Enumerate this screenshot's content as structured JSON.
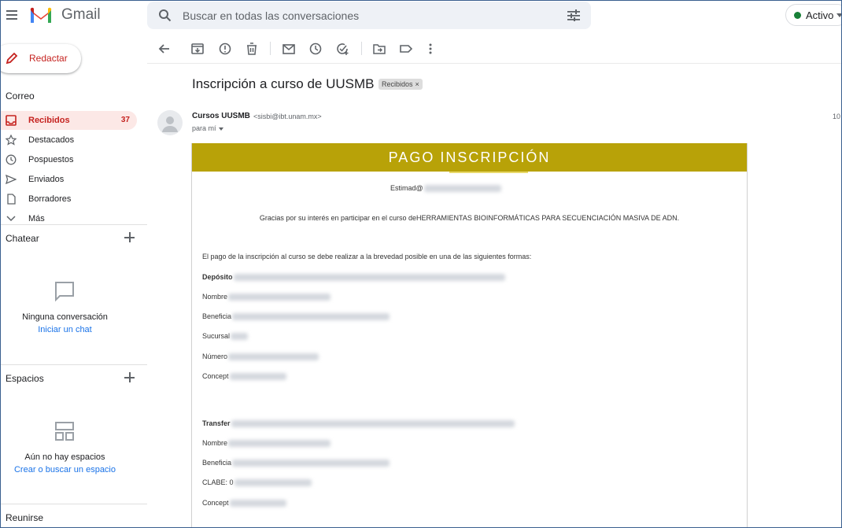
{
  "app": {
    "name": "Gmail"
  },
  "search": {
    "placeholder": "Buscar en todas las conversaciones"
  },
  "status": {
    "label": "Activo",
    "color": "#188038"
  },
  "sidebar": {
    "compose_label": "Redactar",
    "mail_section": "Correo",
    "items": [
      {
        "label": "Recibidos",
        "count": "37",
        "icon": "inbox-icon"
      },
      {
        "label": "Destacados",
        "icon": "star-icon"
      },
      {
        "label": "Pospuestos",
        "icon": "clock-icon"
      },
      {
        "label": "Enviados",
        "icon": "send-icon"
      },
      {
        "label": "Borradores",
        "icon": "draft-icon"
      },
      {
        "label": "Más",
        "icon": "chevron-down-icon"
      }
    ],
    "chat": {
      "title": "Chatear",
      "empty": "Ninguna conversación",
      "action": "Iniciar un chat"
    },
    "spaces": {
      "title": "Espacios",
      "empty": "Aún no hay espacios",
      "action": "Crear o buscar un espacio"
    },
    "meet": {
      "title": "Reunirse"
    }
  },
  "toolbar": {
    "icons": [
      "back-icon",
      "archive-icon",
      "report-spam-icon",
      "delete-icon",
      "mark-unread-icon",
      "snooze-icon",
      "add-task-icon",
      "move-to-icon",
      "label-icon",
      "more-icon"
    ]
  },
  "message": {
    "subject": "Inscripción a curso de UUSMB",
    "label_chip": "Recibidos",
    "sender_name": "Cursos UUSMB",
    "sender_email": "<sisbi@ibt.unam.mx>",
    "to": "para mí",
    "time": "10"
  },
  "email": {
    "banner": "PAGO INSCRIPCIÓN",
    "banner_color": "#b8a208",
    "greeting": "Estimad@",
    "intro": "Gracias por su interés en participar en el curso deHERRAMIENTAS BIOINFORMÁTICAS PARA SECUENCIACIÓN MASIVA DE ADN.",
    "payment_intro": "El pago de la inscripción al curso se debe realizar a la brevedad posible en una de las siguientes formas:",
    "deposit": {
      "title": "Depósito",
      "fields": [
        "Nombre",
        "Beneficia",
        "Sucursal",
        "Número",
        "Concept"
      ]
    },
    "transfer": {
      "title": "Transfer",
      "fields": [
        "Nombre",
        "Beneficia",
        "CLABE: 0",
        "Concept"
      ]
    }
  }
}
